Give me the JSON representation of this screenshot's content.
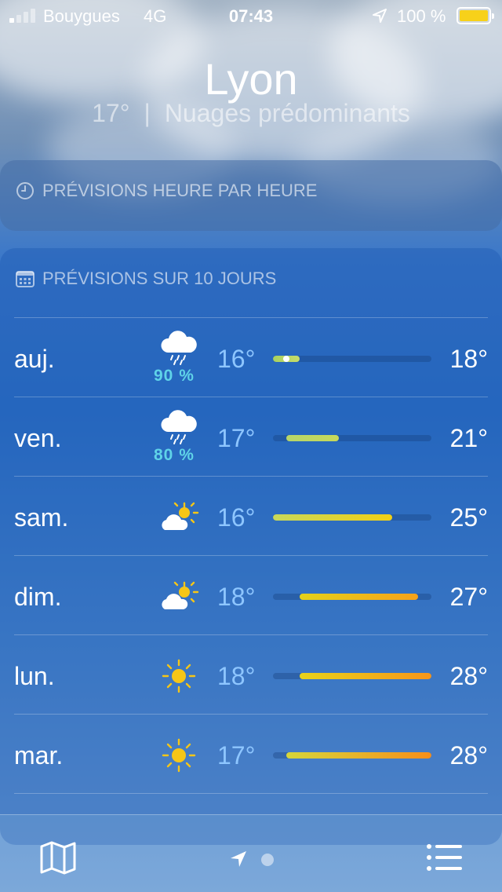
{
  "status_bar": {
    "carrier": "Bouygues",
    "network": "4G",
    "time": "07:43",
    "battery_percent": "100 %",
    "signal_bars_active": 1,
    "signal_bars_total": 4
  },
  "header": {
    "city": "Lyon",
    "current_temp": "17°",
    "separator": "|",
    "condition": "Nuages prédominants"
  },
  "hourly_card": {
    "title": "PRÉVISIONS HEURE PAR HEURE",
    "icon": "clock-icon"
  },
  "daily_card": {
    "title": "PRÉVISIONS SUR 10 JOURS",
    "icon": "calendar-icon",
    "range_min": 16,
    "range_max": 28,
    "days": [
      {
        "day": "auj.",
        "icon": "cloud-rain-icon",
        "precip": "90 %",
        "low": "16°",
        "high": "18°",
        "low_val": 16,
        "high_val": 18,
        "current_val": 17,
        "colors": [
          "#a8d160",
          "#c6dc6a"
        ]
      },
      {
        "day": "ven.",
        "icon": "cloud-rain-icon",
        "precip": "80 %",
        "low": "17°",
        "high": "21°",
        "low_val": 17,
        "high_val": 21,
        "colors": [
          "#b6d66a",
          "#c7d85a"
        ]
      },
      {
        "day": "sam.",
        "icon": "sun-cloud-icon",
        "precip": "",
        "low": "16°",
        "high": "25°",
        "low_val": 16,
        "high_val": 25,
        "colors": [
          "#c8d85a",
          "#f1d015"
        ]
      },
      {
        "day": "dim.",
        "icon": "sun-cloud-icon",
        "precip": "",
        "low": "18°",
        "high": "27°",
        "low_val": 18,
        "high_val": 27,
        "colors": [
          "#e4d21a",
          "#f6a21a"
        ]
      },
      {
        "day": "lun.",
        "icon": "sun-icon",
        "precip": "",
        "low": "18°",
        "high": "28°",
        "low_val": 18,
        "high_val": 28,
        "colors": [
          "#e8d31a",
          "#f7961a"
        ]
      },
      {
        "day": "mar.",
        "icon": "sun-icon",
        "precip": "",
        "low": "17°",
        "high": "28°",
        "low_val": 17,
        "high_val": 28,
        "colors": [
          "#d6d63a",
          "#f78f1a"
        ]
      }
    ]
  },
  "toolbar": {
    "map_icon": "map-icon",
    "location_icon": "location-arrow-icon",
    "list_icon": "list-icon"
  },
  "colors": {
    "precip_text": "#5fd3e8",
    "low_temp_text": "#8ec6ff",
    "battery_fill": "#f7d11a"
  }
}
